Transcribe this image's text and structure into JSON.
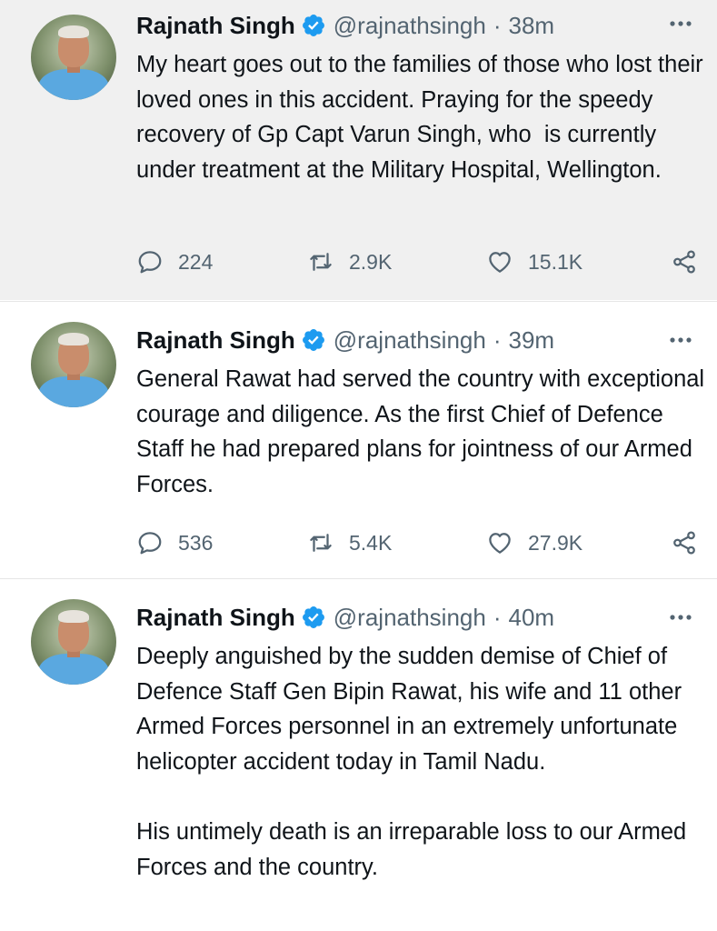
{
  "tweets": [
    {
      "author": "Rajnath Singh",
      "handle": "@rajnathsingh",
      "separator": "·",
      "time": "38m",
      "text": "My heart goes out to the families of those who lost their loved ones in this accident. Praying for the speedy recovery of Gp Capt Varun Singh, who  is currently under treatment at the Military Hospital, Wellington.",
      "replies": "224",
      "retweets": "2.9K",
      "likes": "15.1K"
    },
    {
      "author": "Rajnath Singh",
      "handle": "@rajnathsingh",
      "separator": "·",
      "time": "39m",
      "text": "General Rawat had served the country with exceptional courage and diligence. As the first Chief of Defence Staff he had prepared plans for jointness of our Armed Forces.",
      "replies": "536",
      "retweets": "5.4K",
      "likes": "27.9K"
    },
    {
      "author": "Rajnath Singh",
      "handle": "@rajnathsingh",
      "separator": "·",
      "time": "40m",
      "text": "Deeply anguished by the sudden demise of Chief of Defence Staff Gen Bipin Rawat, his wife and 11 other Armed Forces personnel in an extremely unfortunate helicopter accident today in Tamil Nadu.\n\nHis untimely death is an irreparable loss to our Armed Forces and the country."
    }
  ],
  "icons": {
    "verified": "verified-badge-icon",
    "more": "more-options-icon",
    "reply": "reply-icon",
    "retweet": "retweet-icon",
    "like": "like-icon",
    "share": "share-icon"
  },
  "colors": {
    "verified_blue": "#1d9bf0",
    "secondary_text": "#536471",
    "highlight_background": "#f0f0f0"
  }
}
